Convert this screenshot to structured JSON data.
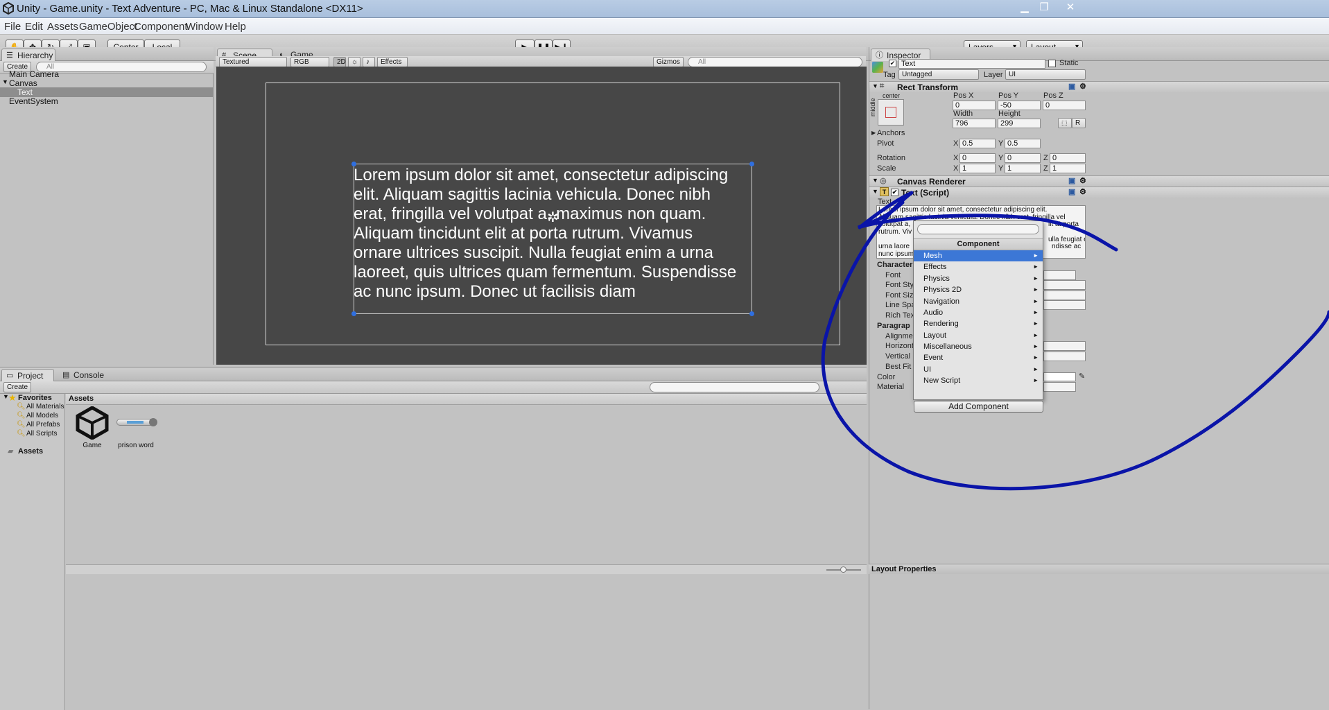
{
  "window": {
    "title": "Unity - Game.unity - Text Adventure - PC, Mac & Linux Standalone <DX11>"
  },
  "menu": [
    "File",
    "Edit",
    "Assets",
    "GameObject",
    "Component",
    "Window",
    "Help"
  ],
  "toolbar": {
    "center": "Center",
    "local": "Local",
    "layers": "Layers",
    "layout": "Layout"
  },
  "hierarchy": {
    "tab": "Hierarchy",
    "create": "Create",
    "search": "All",
    "items": [
      {
        "label": "Main Camera"
      },
      {
        "label": "Canvas"
      },
      {
        "label": "Text"
      },
      {
        "label": "EventSystem"
      }
    ]
  },
  "scene": {
    "tabs": [
      "Scene",
      "Game"
    ],
    "shading": "Textured",
    "color": "RGB",
    "mode2d": "2D",
    "effects": "Effects",
    "gizmos": "Gizmos",
    "search": "All",
    "text": "Lorem ipsum dolor sit amet, consectetur adipiscing elit. Aliquam sagittis lacinia vehicula. Donec nibh erat, fringilla vel volutpat a, maximus non quam. Aliquam tincidunt elit at porta rutrum. Vivamus ornare ultrices suscipit. Nulla feugiat enim a urna laoreet, quis ultrices quam fermentum. Suspendisse ac nunc ipsum. Donec ut facilisis diam",
    "lines": [
      "Lorem ipsum dolor sit amet, consectetur adipiscing",
      "elit. Aliquam sagittis lacinia vehicula. Donec nibh",
      "erat, fringilla vel volutpat a, maximus non quam.",
      "Aliquam tincidunt elit at porta rutrum. Vivamus",
      "ornare ultrices suscipit. Nulla feugiat enim a urna",
      "laoreet, quis ultrices quam fermentum. Suspendisse",
      "ac nunc ipsum. Donec ut facilisis diam"
    ]
  },
  "project": {
    "tabs": [
      "Project",
      "Console"
    ],
    "create": "Create",
    "favorites": {
      "title": "Favorites",
      "items": [
        "All Materials",
        "All Models",
        "All Prefabs",
        "All Scripts"
      ]
    },
    "assets_root": "Assets",
    "assets_header": "Assets",
    "assets": [
      {
        "name": "Game",
        "icon": "unity-scene-icon"
      },
      {
        "name": "prison word",
        "icon": "script-asset-icon"
      }
    ]
  },
  "inspector": {
    "tab": "Inspector",
    "object_name": "Text",
    "static": "Static",
    "tag_label": "Tag",
    "tag": "Untagged",
    "layer_label": "Layer",
    "layer": "UI",
    "rect_transform": {
      "title": "Rect Transform",
      "anchor_h": "center",
      "anchor_v": "middle",
      "posx_label": "Pos X",
      "posy_label": "Pos Y",
      "posz_label": "Pos Z",
      "posx": "0",
      "posy": "-50",
      "posz": "0",
      "width_label": "Width",
      "height_label": "Height",
      "width": "796",
      "height": "299",
      "anchors": "Anchors",
      "pivot": "Pivot",
      "pivot_x": "0.5",
      "pivot_y": "0.5",
      "rotation": "Rotation",
      "rot_x": "0",
      "rot_y": "0",
      "rot_z": "0",
      "scale": "Scale",
      "scale_x": "1",
      "scale_y": "1",
      "scale_z": "1",
      "x": "X",
      "y": "Y",
      "z": "Z",
      "r_btn": "R"
    },
    "canvas_renderer": "Canvas Renderer",
    "text_script": {
      "title": "Text (Script)",
      "text_label": "Text",
      "text_preview": [
        "Lorem ipsum dolor sit amet, consectetur adipiscing elit.",
        "Aliquam sagittis lacinia vehicula. Donec nibh erat, fringilla vel",
        "volutpat a,",
        "lit at porta",
        "rutrum. Viv",
        "ulla feugiat enim a",
        "urna laore",
        "ndisse ac",
        "nunc ipsum"
      ],
      "character": "Character",
      "font": "Font",
      "font_style": "Font Sty",
      "font_size": "Font Size",
      "line_spacing": "Line Spa",
      "rich_text": "Rich Tex",
      "paragraph": "Paragrap",
      "alignment": "Alignmen",
      "horizontal": "Horizont",
      "vertical": "Vertical",
      "best_fit": "Best Fit",
      "color": "Color",
      "material": "Material"
    },
    "add_component_menu": {
      "title": "Component",
      "items": [
        "Mesh",
        "Effects",
        "Physics",
        "Physics 2D",
        "Navigation",
        "Audio",
        "Rendering",
        "Layout",
        "Miscellaneous",
        "Event",
        "UI",
        "New Script"
      ],
      "selected": "Mesh"
    },
    "add_component": "Add Component",
    "layout_properties": "Layout Properties"
  },
  "colors": {
    "selection": "#3c77d6",
    "annotation": "#0a14a8",
    "scene_bg": "#474747"
  }
}
